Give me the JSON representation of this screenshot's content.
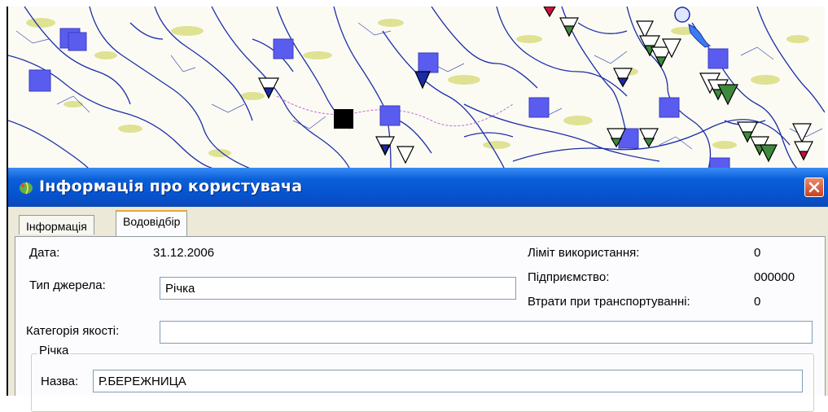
{
  "window": {
    "title": "Інформація про користувача"
  },
  "tabs": [
    {
      "label": "Інформація",
      "active": false
    },
    {
      "label": "Водовідбір",
      "active": true
    }
  ],
  "form": {
    "date_label": "Дата:",
    "date_value": "31.12.2006",
    "source_type_label": "Тип джерела:",
    "source_type_value": "Річка",
    "quality_label": "Категорія якості:",
    "quality_value": "",
    "limit_label": "Ліміт використання:",
    "limit_value": "0",
    "enterprise_label": "Підприємство:",
    "enterprise_value": "000000",
    "losses_label": "Втрати при транспортуванні:",
    "losses_value": "0"
  },
  "river_group": {
    "title": "Річка",
    "name_label": "Назва:",
    "name_value": "Р.БЕРЕЖНИЦА"
  },
  "colors": {
    "titlebar": "#0653cf",
    "river_lines": "#1c2ea8",
    "square_marker": "#5a5cf0",
    "triangle_green": "#3d8a3d",
    "triangle_blue": "#1a2aa8"
  },
  "map_icons": [
    "square-marker",
    "triangle-marker",
    "selected-square-marker"
  ]
}
